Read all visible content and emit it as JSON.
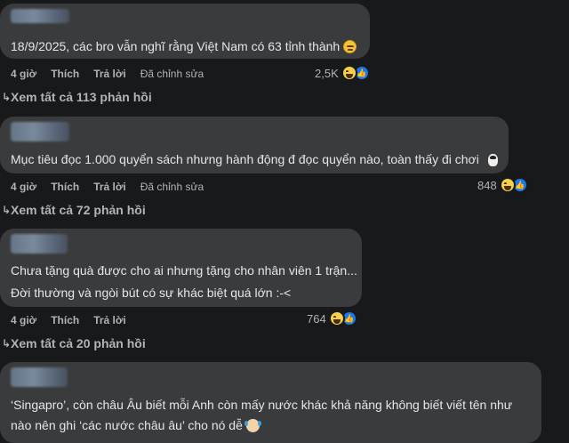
{
  "comments": [
    {
      "text_lines": [
        "18/9/2025, các bro vẫn nghĩ rằng Việt Nam có 63 tỉnh thành"
      ],
      "emoji": "sweat-smile-emoji",
      "time": "4 giờ",
      "like": "Thích",
      "reply": "Trả lời",
      "edited": "Đã chỉnh sửa",
      "reaction_count": "2,5K",
      "view_replies": "Xem tất cả 113 phản hồi"
    },
    {
      "text_lines": [
        "Mục tiêu đọc 1.000 quyển sách nhưng hành động đ đọc quyển nào, toàn thấy đi chơi"
      ],
      "emoji": "penguin-emoji",
      "time": "4 giờ",
      "like": "Thích",
      "reply": "Trả lời",
      "edited": "Đã chỉnh sửa",
      "reaction_count": "848",
      "view_replies": "Xem tất cả 72 phản hồi"
    },
    {
      "text_lines": [
        "Chưa tặng quà được cho ai nhưng tặng cho nhân viên 1 trận...",
        "Đời thường và ngòi bút có sự khác biệt quá lớn :-<"
      ],
      "time": "4 giờ",
      "like": "Thích",
      "reply": "Trả lời",
      "reaction_count": "764",
      "view_replies": "Xem tất cả 20 phản hồi"
    },
    {
      "text_lines": [
        "‘Singapro’, còn châu Âu biết mỗi Anh còn mấy nước khác khả năng không biết viết tên như",
        "nào nên ghi ‘các nước châu âu’ cho nó dễ"
      ],
      "emoji": "clown-emoji"
    }
  ],
  "colors": {
    "background": "#18191a",
    "bubble": "#3a3b3c",
    "text": "#e4e6eb",
    "meta": "#b0b3b8",
    "like_blue": "#1877f2"
  }
}
